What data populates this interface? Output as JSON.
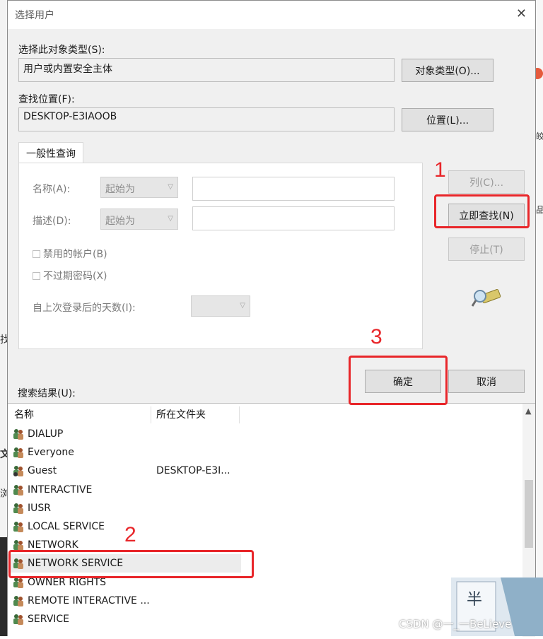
{
  "dialog": {
    "title": "选择用户",
    "close_glyph": "✕"
  },
  "object_type": {
    "label": "选择此对象类型(S):",
    "value": "用户或内置安全主体",
    "button": "对象类型(O)..."
  },
  "location": {
    "label": "查找位置(F):",
    "value": "DESKTOP-E3IAOOB",
    "button": "位置(L)..."
  },
  "query": {
    "tab": "一般性查询",
    "name_label": "名称(A):",
    "name_op": "起始为",
    "desc_label": "描述(D):",
    "desc_op": "起始为",
    "disabled_accounts": "禁用的帐户(B)",
    "non_expiring_pw": "不过期密码(X)",
    "days_label": "自上次登录后的天数(I):"
  },
  "side_buttons": {
    "columns": "列(C)...",
    "find_now": "立即查找(N)",
    "stop": "停止(T)"
  },
  "actions": {
    "ok": "确定",
    "cancel": "取消"
  },
  "results": {
    "label": "搜索结果(U):",
    "col_name": "名称",
    "col_folder": "所在文件夹",
    "rows": [
      {
        "name": "DIALUP",
        "folder": ""
      },
      {
        "name": "Everyone",
        "folder": ""
      },
      {
        "name": "Guest",
        "folder": "DESKTOP-E3I..."
      },
      {
        "name": "INTERACTIVE",
        "folder": ""
      },
      {
        "name": "IUSR",
        "folder": ""
      },
      {
        "name": "LOCAL SERVICE",
        "folder": ""
      },
      {
        "name": "NETWORK",
        "folder": ""
      },
      {
        "name": "NETWORK SERVICE",
        "folder": ""
      },
      {
        "name": "OWNER RIGHTS",
        "folder": ""
      },
      {
        "name": "REMOTE INTERACTIVE ...",
        "folder": ""
      },
      {
        "name": "SERVICE",
        "folder": ""
      }
    ]
  },
  "annotations": {
    "n1": "1",
    "n2": "2",
    "n3": "3",
    "color": "#e8262a"
  },
  "watermark": {
    "text": "CSDN @一_一BeLieve",
    "tile_text": "半"
  },
  "background": {
    "char_a": "找",
    "char_b": "文",
    "char_c": "浏",
    "char_d": "皎",
    "char_e": "品"
  }
}
